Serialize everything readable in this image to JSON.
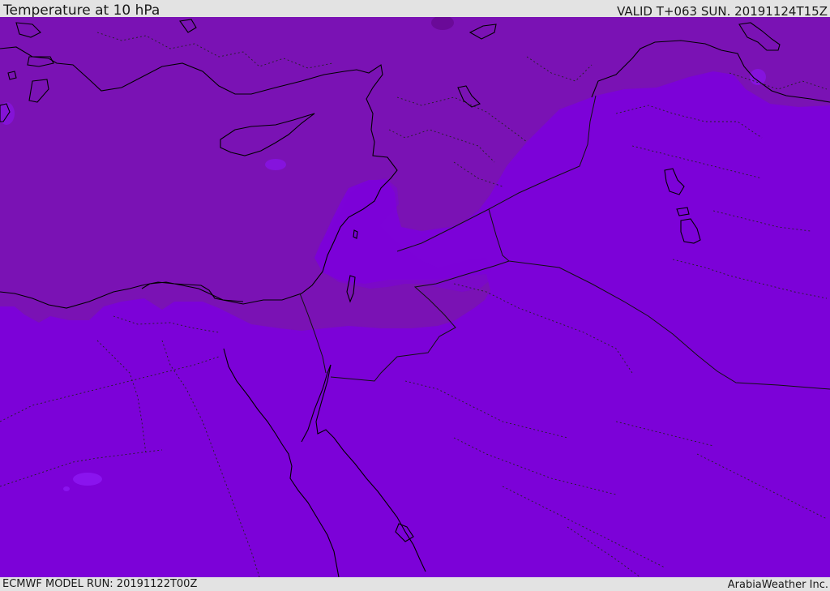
{
  "header": {
    "title": "Temperature at 10 hPa",
    "valid_time": "VALID T+063 SUN. 20191124T15Z"
  },
  "footer": {
    "model_run": "ECMWF MODEL RUN: 20191122T00Z",
    "credit": "ArabiaWeather Inc."
  },
  "map": {
    "region": "Eastern Mediterranean / Middle East",
    "colors": {
      "warm_band": "#7a12b4",
      "cold_field": "#7c02d8",
      "pockets": "#8a14ee",
      "coast_line": "#000000",
      "border_line": "#1a1a1a"
    }
  }
}
